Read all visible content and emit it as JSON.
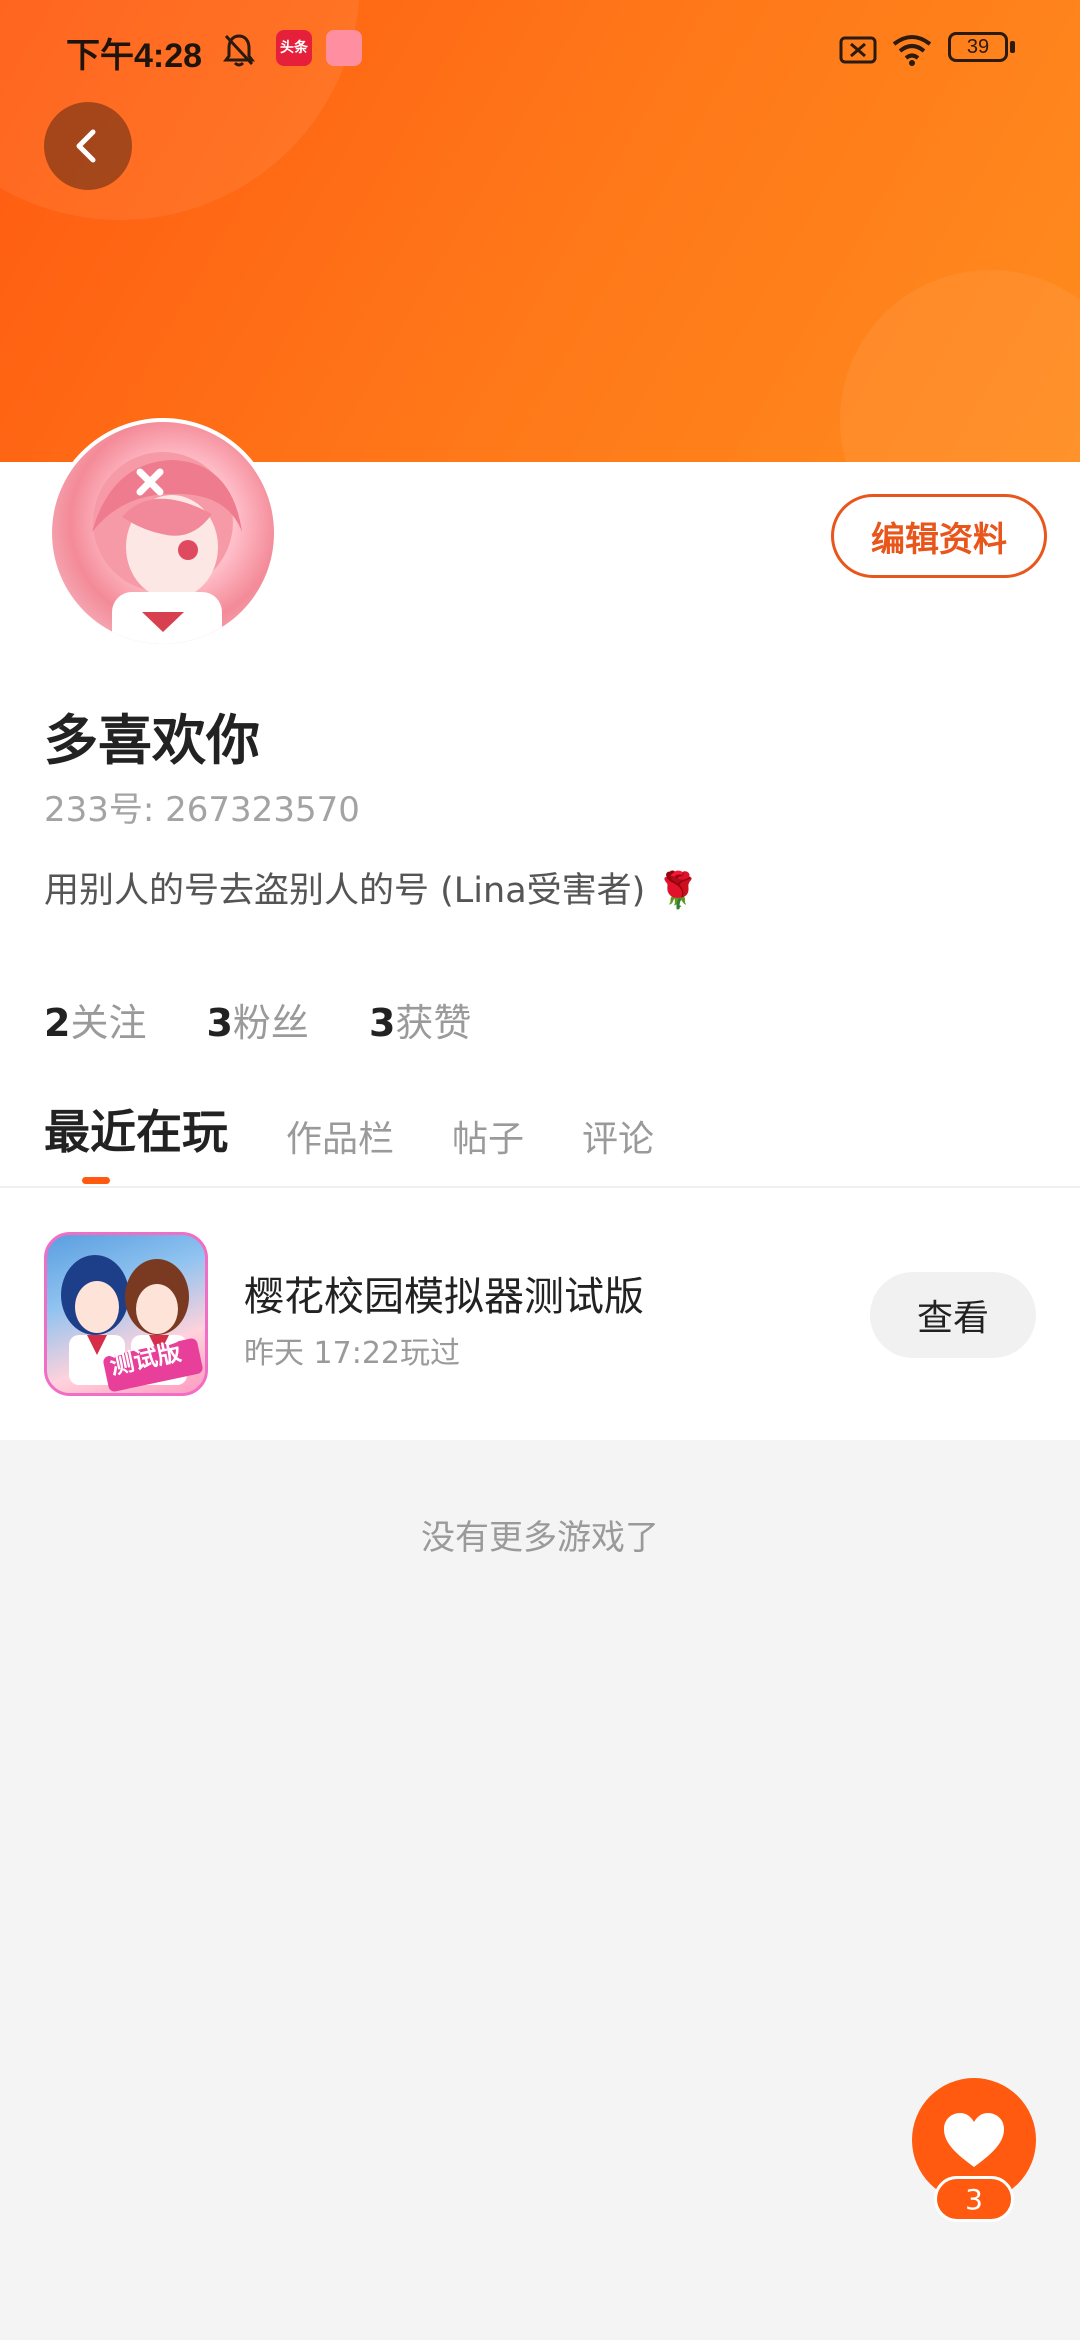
{
  "status_bar": {
    "time": "下午4:28",
    "battery": "39",
    "icons": [
      "bell-off-icon",
      "toutiao-app-icon",
      "store-app-icon",
      "sim-off-icon",
      "wifi-icon",
      "battery-icon"
    ],
    "app_badge_label": "头条"
  },
  "header": {
    "back_icon": "chevron-left-icon"
  },
  "profile": {
    "edit_button": "编辑资料",
    "nickname": "多喜欢你",
    "uid_text": "233号: 267323570",
    "bio": "用别人的号去盗别人的号 (Lina受害者) 🌹",
    "stats": [
      {
        "count": "2",
        "label": "关注"
      },
      {
        "count": "3",
        "label": "粉丝"
      },
      {
        "count": "3",
        "label": "获赞"
      }
    ]
  },
  "tabs": [
    {
      "label": "最近在玩",
      "active": true
    },
    {
      "label": "作品栏",
      "active": false
    },
    {
      "label": "帖子",
      "active": false
    },
    {
      "label": "评论",
      "active": false
    }
  ],
  "recent_games": [
    {
      "title": "樱花校园模拟器测试版",
      "played_time": "昨天 17:22玩过",
      "icon_badge": "测试版",
      "action": "查看"
    }
  ],
  "footer_note": "没有更多游戏了",
  "like_fab": {
    "icon": "heart-icon",
    "count": "3"
  },
  "colors": {
    "accent": "#ff5a10",
    "edit_border": "#e8561b",
    "page_bg": "#f4f4f4"
  }
}
